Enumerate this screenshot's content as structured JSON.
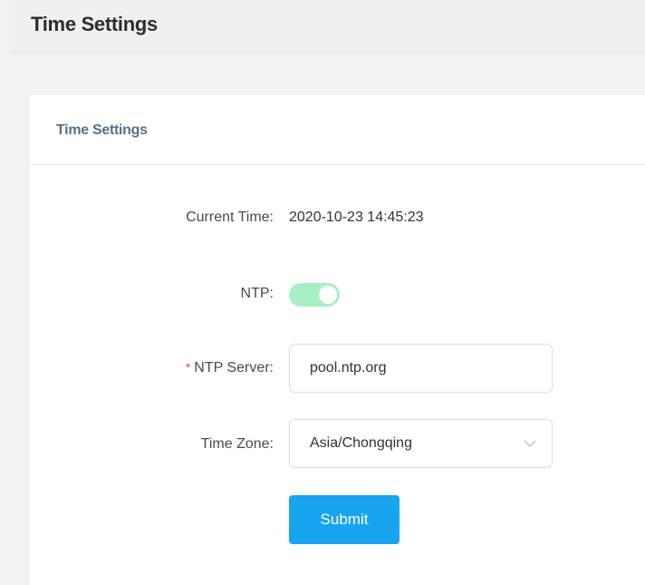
{
  "page": {
    "title": "Time Settings"
  },
  "card": {
    "title": "Time Settings",
    "current_time": {
      "label": "Current Time:",
      "value": "2020-10-23 14:45:23"
    },
    "ntp": {
      "label": "NTP:",
      "enabled": true
    },
    "ntp_server": {
      "required_mark": "*",
      "label": "NTP Server:",
      "value": "pool.ntp.org"
    },
    "time_zone": {
      "label": "Time Zone:",
      "value": "Asia/Chongqing"
    },
    "submit_label": "Submit"
  },
  "colors": {
    "accent": "#17a5f0",
    "switch_on": "#a8efc4",
    "required": "#e24b4b",
    "card_title": "#5b6f86"
  },
  "icons": {
    "dropdown": "chevron-down-icon"
  }
}
